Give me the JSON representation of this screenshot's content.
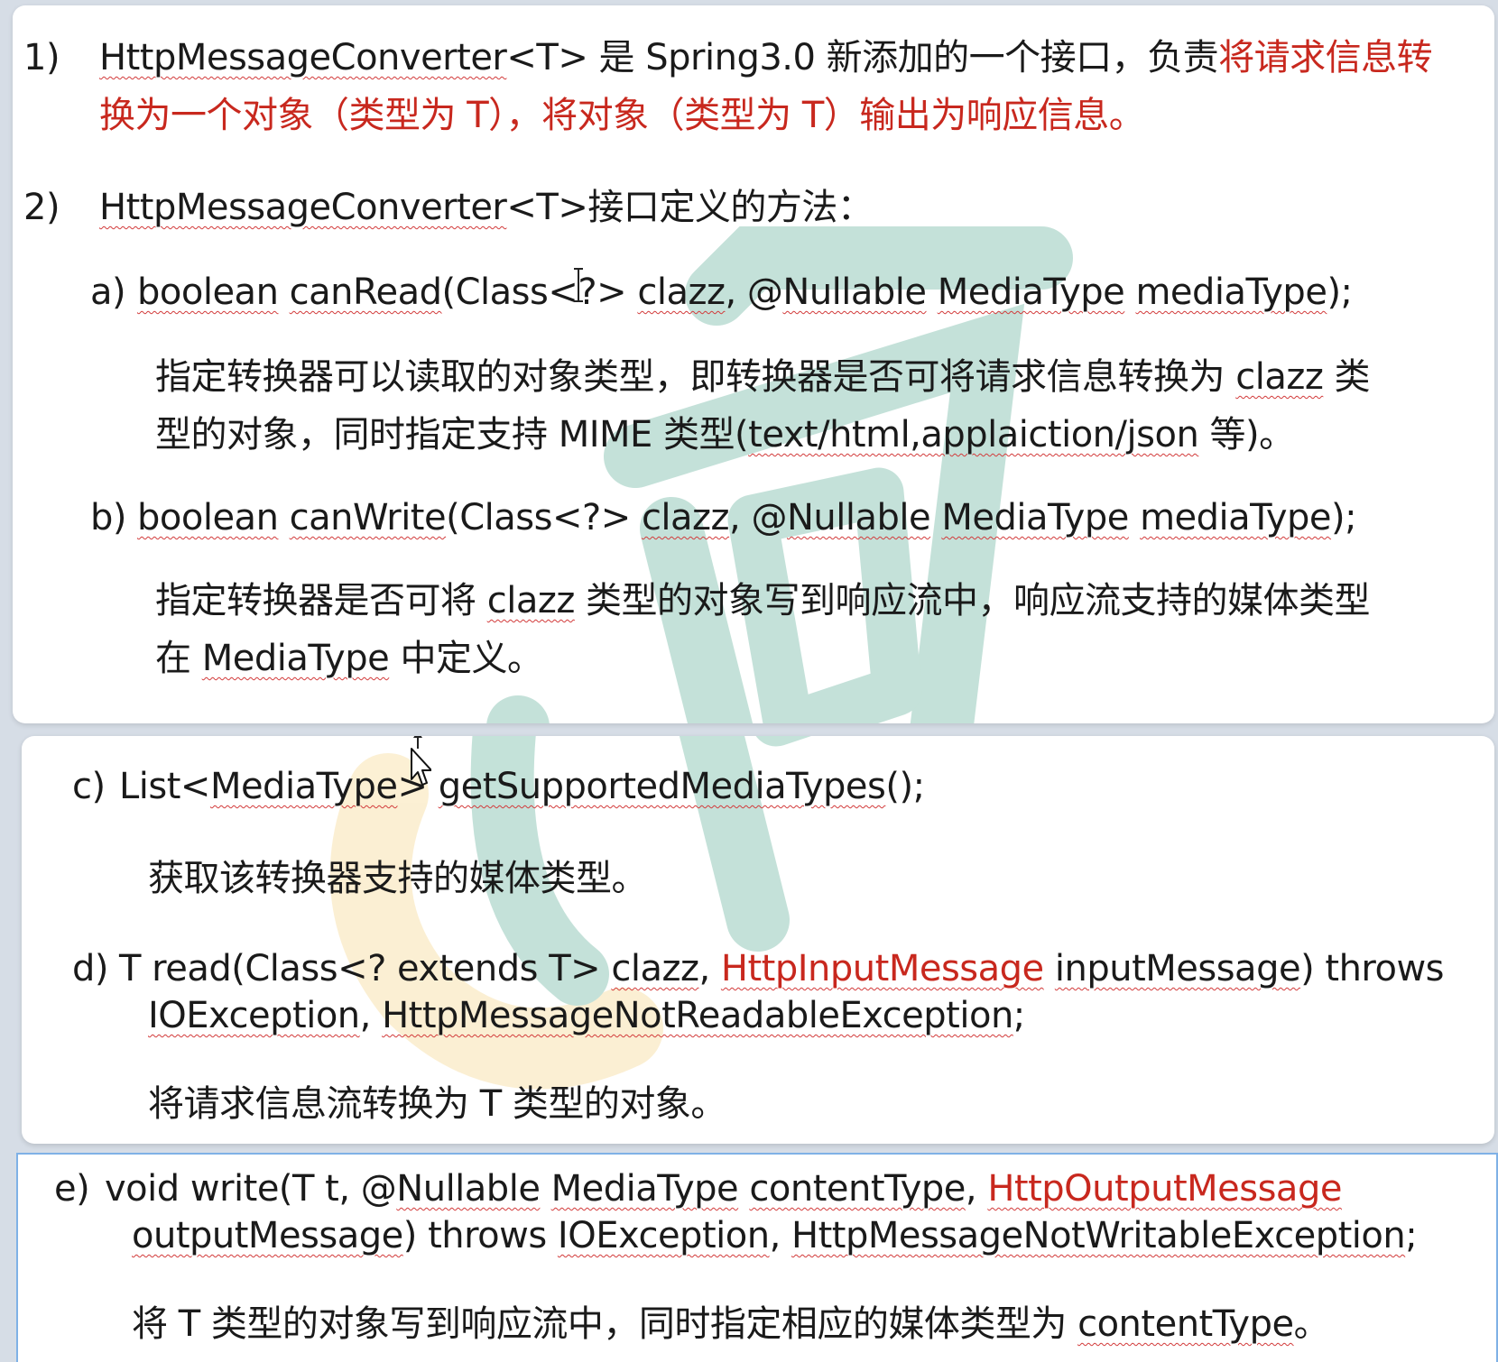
{
  "item1": {
    "num": "1)",
    "l1_iface": "HttpMessageConverter",
    "l1_generic": "<T>",
    "l1_text": " 是 Spring3.0 新添加的一个接口，负责",
    "l1_red": "将请求信息转",
    "l2_red": "换为一个对象（类型为 T），将对象（类型为 T）输出为响应信息。"
  },
  "item2": {
    "num": "2)",
    "iface": "HttpMessageConverter",
    "rest": "<T>接口定义的方法："
  },
  "method_a": {
    "label": "a)",
    "sig": [
      "boolean",
      " ",
      "canRead",
      "(Class<?> ",
      "clazz",
      ", @",
      "Nullable",
      " ",
      "MediaType",
      " ",
      "mediaType",
      ");"
    ],
    "desc1": [
      "指定转换器可以读取的对象类型，即转换器是否可将请求信息转换为 ",
      "clazz",
      " 类"
    ],
    "desc2": [
      "型的对象，同时指定支持 MIME 类型(",
      "text/html,applaiction/json",
      " 等)。"
    ]
  },
  "method_b": {
    "label": "b)",
    "sig": [
      "boolean",
      " ",
      "canWrite",
      "(Class<?> ",
      "clazz",
      ", @",
      "Nullable",
      " ",
      "MediaType",
      " ",
      "mediaType",
      ");"
    ],
    "desc1": [
      "指定转换器是否可将 ",
      "clazz",
      " 类型的对象写到响应流中，响应流支持的媒体类型"
    ],
    "desc2": [
      "在 ",
      "MediaType",
      " 中定义。"
    ]
  },
  "method_c": {
    "label": "c)",
    "sig": [
      "List<",
      "MediaType",
      "> ",
      "getSupportedMediaTypes",
      "();"
    ],
    "desc": "获取该转换器支持的媒体类型。"
  },
  "method_d": {
    "label": "d)",
    "sig1": [
      "T read(Class<? extends T> ",
      "clazz",
      ", ",
      "HttpInputMessage",
      " ",
      "inputMessage",
      ") throws"
    ],
    "sig2": [
      "IOException",
      ", ",
      "HttpMessageNotReadableException",
      ";"
    ],
    "desc": "将请求信息流转换为 T 类型的对象。"
  },
  "method_e": {
    "label": "e)",
    "sig1": [
      "void write(T t, @",
      "Nullable",
      " ",
      "MediaType",
      " ",
      "contentType",
      ", ",
      "HttpOutputMessage"
    ],
    "sig2": [
      "outputMessage",
      ") throws ",
      "IOException",
      ", ",
      "HttpMessageNotWritableException",
      ";"
    ],
    "desc": [
      "将 T 类型的对象写到响应流中，同时指定相应的媒体类型为 ",
      "contentType",
      "。"
    ]
  },
  "colors": {
    "emphasis_red": "#c8281e",
    "spell_underline": "#d23a3a",
    "watermark_green": "#1e8e6e",
    "watermark_yellow": "#f2c45a"
  }
}
